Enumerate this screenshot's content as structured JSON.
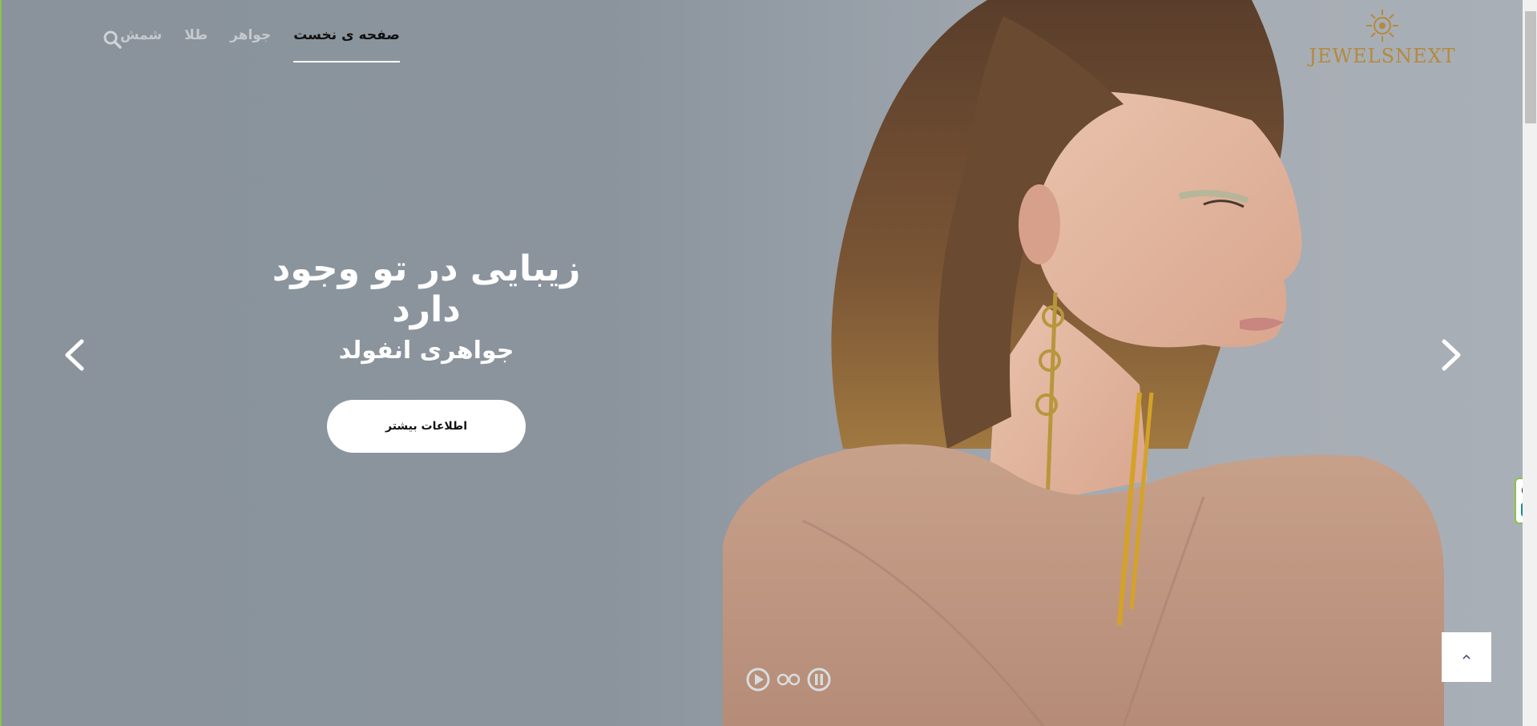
{
  "brand": {
    "logo_text": "JEWELSNEXT"
  },
  "nav": {
    "items": [
      {
        "label": "صفحه ی نخست",
        "active": true
      },
      {
        "label": "جواهر",
        "active": false
      },
      {
        "label": "طلا",
        "active": false
      },
      {
        "label": "شمش",
        "active": false
      }
    ],
    "search_icon": "search-icon"
  },
  "slide": {
    "title": "زیبایی در تو وجود دارد",
    "subtitle": "جواهری انفولد",
    "cta_label": "اطلاعات بیشتر"
  },
  "slider_controls": {
    "prev_icon": "chevron-left-icon",
    "next_icon": "chevron-right-icon",
    "play_icon": "play-icon",
    "dots_icon": "dots-icon",
    "pause_icon": "pause-icon"
  },
  "back_to_top": {
    "label": "^"
  },
  "colors": {
    "accent": "#8bc34a",
    "gold": "#b48a3c",
    "hero_bg": "#8b949d"
  }
}
